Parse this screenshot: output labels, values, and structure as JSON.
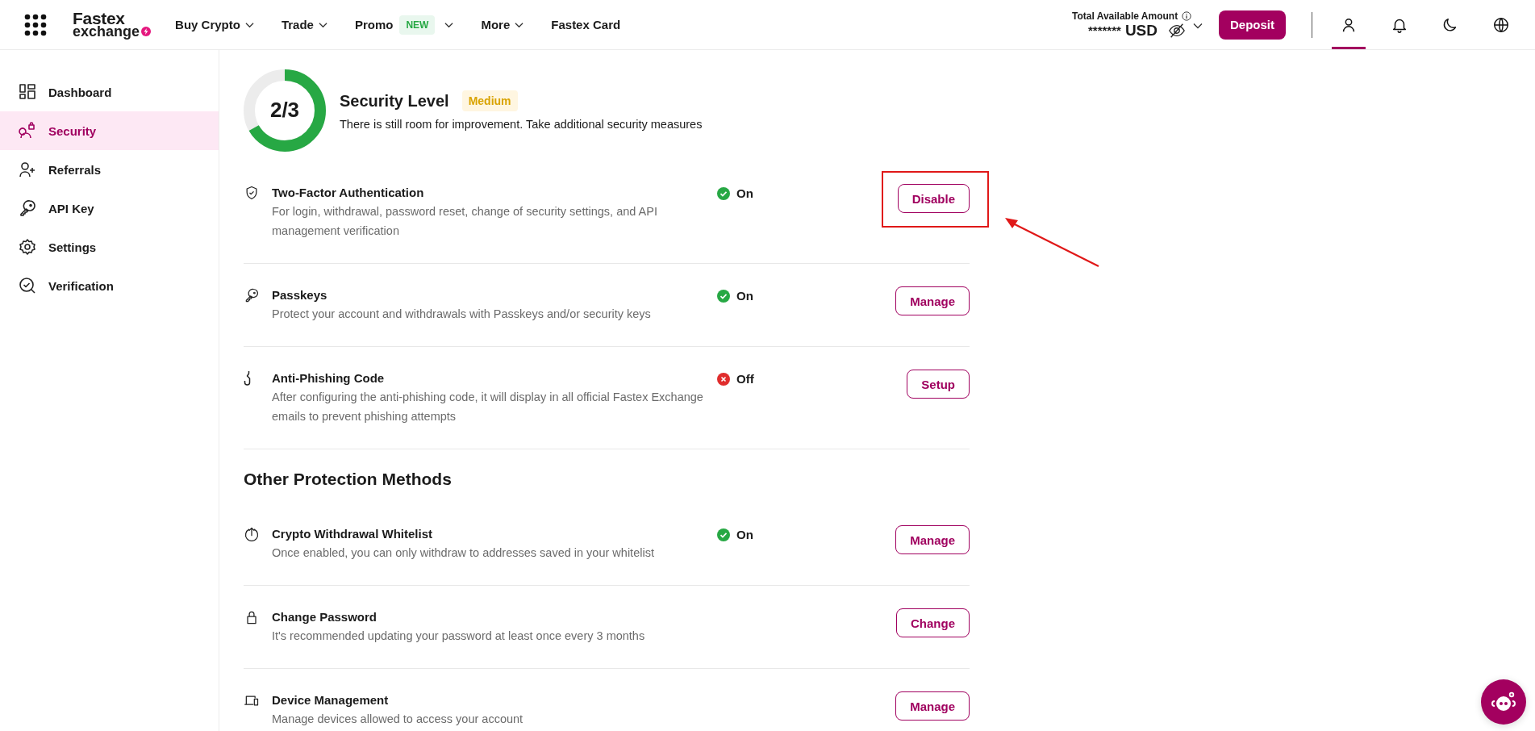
{
  "header": {
    "logo": {
      "line1": "Fastex",
      "line2": "exchange"
    },
    "nav": [
      {
        "label": "Buy Crypto",
        "dropdown": true
      },
      {
        "label": "Trade",
        "dropdown": true
      },
      {
        "label": "Promo",
        "badge": "NEW",
        "dropdown": true
      },
      {
        "label": "More",
        "dropdown": true
      },
      {
        "label": "Fastex Card",
        "dropdown": false
      }
    ],
    "balance": {
      "label": "Total Available Amount",
      "amount": "*******",
      "currency": "USD",
      "hidden": true
    },
    "deposit_button": "Deposit",
    "icons": [
      {
        "selected": true
      },
      {
        "selected": false
      },
      {
        "selected": false
      },
      {
        "selected": false
      }
    ]
  },
  "sidebar": {
    "items": [
      {
        "label": "Dashboard",
        "selected": false
      },
      {
        "label": "Security",
        "selected": true
      },
      {
        "label": "Referrals",
        "selected": false
      },
      {
        "label": "API Key",
        "selected": false
      },
      {
        "label": "Settings",
        "selected": false
      },
      {
        "label": "Verification",
        "selected": false
      }
    ]
  },
  "security_level": {
    "score": "2/3",
    "level": 0.667,
    "title": "Security Level",
    "badge": "Medium",
    "description": "There is still room for improvement. Take additional security measures"
  },
  "methods": [
    {
      "title": "Two-Factor Authentication",
      "description": "For login, withdrawal, password reset, change of security settings, and API management verification",
      "status": {
        "text": "On",
        "on": true
      },
      "button": "Disable",
      "highlighted": true
    },
    {
      "title": "Passkeys",
      "description": "Protect your account and withdrawals with Passkeys and/or security keys",
      "status": {
        "text": "On",
        "on": true
      },
      "button": "Manage",
      "highlighted": false
    },
    {
      "title": "Anti-Phishing Code",
      "description": "After configuring the anti-phishing code, it will display in all official Fastex Exchange emails to prevent phishing attempts",
      "status": {
        "text": "Off",
        "on": false
      },
      "button": "Setup",
      "highlighted": false
    }
  ],
  "other_protection": {
    "heading": "Other Protection Methods",
    "methods": [
      {
        "title": "Crypto Withdrawal Whitelist",
        "description": "Once enabled, you can only withdraw to addresses saved in your whitelist",
        "status": {
          "text": "On",
          "on": true
        },
        "button": "Manage"
      },
      {
        "title": "Change Password",
        "description": "It's recommended updating your password at least once every 3 months",
        "button": "Change"
      },
      {
        "title": "Device Management",
        "description": "Manage devices allowed to access your account",
        "button": "Manage"
      }
    ]
  }
}
